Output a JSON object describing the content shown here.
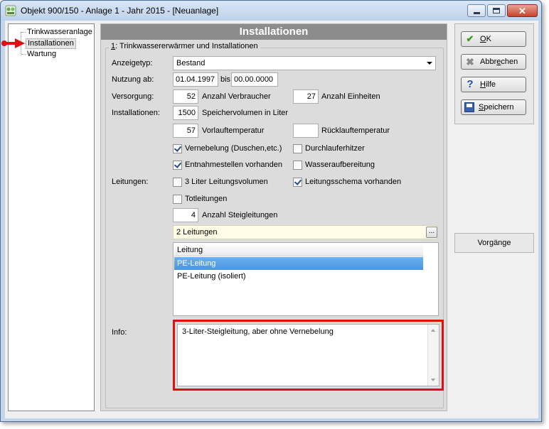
{
  "window": {
    "title": "Objekt 900/150 - Anlage 1 - Jahr 2015 - [Neuanlage]",
    "controls": {
      "close": "✕"
    }
  },
  "tree": {
    "items": [
      {
        "label": "Trinkwasseranlage",
        "selected": false
      },
      {
        "label": "Installationen",
        "selected": true
      },
      {
        "label": "Wartung",
        "selected": false
      }
    ]
  },
  "panel": {
    "header": "Installationen",
    "group_legend_prefix": "1",
    "group_legend_text": ": Trinkwassererwärmer und Installationen"
  },
  "form": {
    "anzeigetyp_label": "Anzeigetyp:",
    "anzeigetyp_value": "Bestand",
    "nutzung_label": "Nutzung ab:",
    "nutzung_from": "01.04.1997",
    "nutzung_bis_label": "bis",
    "nutzung_to": "00.00.0000",
    "versorgung_label": "Versorgung:",
    "verbraucher_value": "52",
    "verbraucher_label": "Anzahl Verbraucher",
    "einheiten_value": "27",
    "einheiten_label": "Anzahl Einheiten",
    "installationen_label": "Installationen:",
    "speicher_value": "1500",
    "speicher_label": "Speichervolumen in Liter",
    "vorlauf_value": "57",
    "vorlauf_label": "Vorlauftemperatur",
    "ruecklauf_value": "",
    "ruecklauf_label": "Rücklauftemperatur",
    "leitungen_label": "Leitungen:",
    "steig_value": "4",
    "steig_label": "Anzahl Steigleitungen",
    "checkboxes": {
      "vernebelung": {
        "label": "Vernebelung (Duschen,etc.)",
        "checked": true
      },
      "durchlauf": {
        "label": "Durchlauferhitzer",
        "checked": false
      },
      "entnahme": {
        "label": "Entnahmestellen vorhanden",
        "checked": true
      },
      "aufbereitung": {
        "label": "Wasseraufbereitung",
        "checked": false
      },
      "drei_liter": {
        "label": "3 Liter Leitungsvolumen",
        "checked": false
      },
      "schema": {
        "label": "Leitungsschema vorhanden",
        "checked": true
      },
      "tot": {
        "label": "Totleitungen",
        "checked": false
      }
    },
    "leitungen_summary": "2 Leitungen",
    "dots_label": "...",
    "list": {
      "header": "Leitung",
      "rows": [
        {
          "label": "PE-Leitung",
          "selected": true
        },
        {
          "label": "PE-Leitung (isoliert)",
          "selected": false
        }
      ]
    },
    "info_label": "Info:",
    "info_text": "3-Liter-Steigleitung, aber ohne Vernebelung"
  },
  "actions": {
    "ok_prefix": "O",
    "ok_rest": "K",
    "cancel_prefix": "Abbr",
    "cancel_mn": "e",
    "cancel_rest": "chen",
    "help_prefix": "",
    "help_mn": "H",
    "help_rest": "ilfe",
    "save_prefix": "",
    "save_mn": "S",
    "save_rest": "peichern",
    "vorgaenge": "Vorgänge"
  },
  "colors": {
    "accent_red": "#e01010",
    "selection_blue": "#4a95e0",
    "header_gray": "#8c8c8c"
  }
}
